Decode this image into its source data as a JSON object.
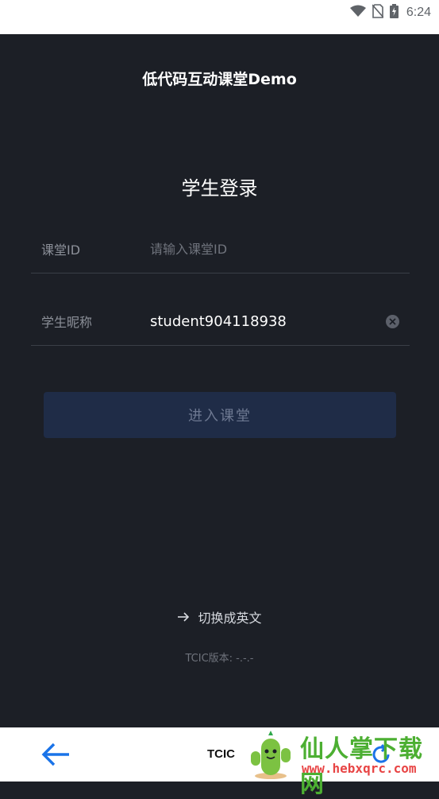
{
  "status_bar": {
    "time": "6:24",
    "icons": [
      "wifi-icon",
      "no-sim-icon",
      "battery-charging-icon"
    ]
  },
  "app": {
    "title": "低代码互动课堂Demo"
  },
  "login": {
    "title": "学生登录",
    "room_id": {
      "label": "课堂ID",
      "value": "",
      "placeholder": "请输入课堂ID"
    },
    "nickname": {
      "label": "学生昵称",
      "value": "student904118938",
      "placeholder": ""
    },
    "enter_button": "进入课堂"
  },
  "footer": {
    "switch_language": "切换成英文",
    "version": "TCIC版本: -.-.-"
  },
  "bottom_bar": {
    "title": "TCIC",
    "icons": [
      "back-arrow-icon",
      "reload-icon"
    ]
  },
  "watermark": {
    "name": "仙人掌下载网",
    "url": "www.hebxqrc.com"
  },
  "colors": {
    "background": "#1c1f26",
    "button_disabled": "#1f2c47",
    "accent_blue": "#1a73e8",
    "watermark_green": "#4caf32",
    "watermark_red": "#e84545"
  }
}
